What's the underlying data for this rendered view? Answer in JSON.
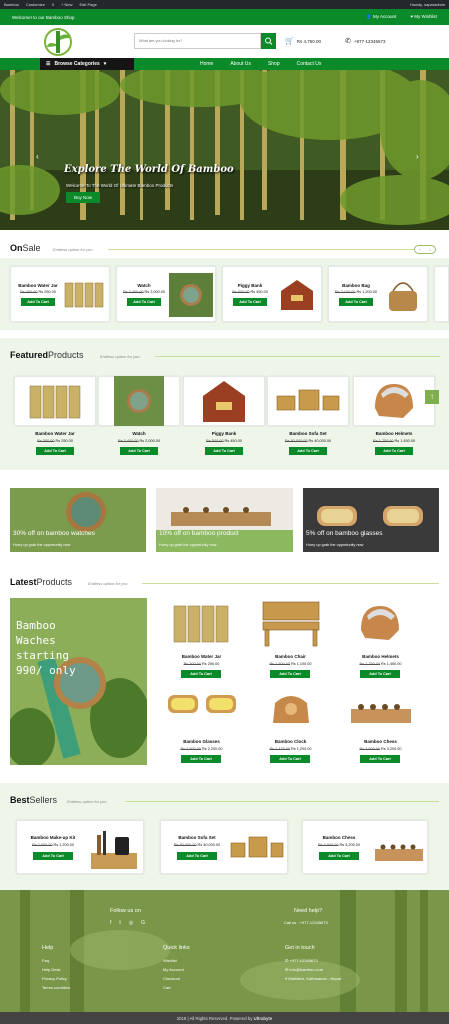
{
  "admin_bar": {
    "items": [
      "Bamboo",
      "Customize",
      "0",
      "+ New",
      "Edit Page"
    ],
    "howdy": "Howdy, saparadmin"
  },
  "topbar": {
    "welcome": "Welcome! to our Bamboo Shop",
    "account": "My Account",
    "wishlist": "My Wishlist"
  },
  "header": {
    "search_placeholder": "What are you looking for?",
    "cart_total": "Rs 4,750.00",
    "phone": "+977-12345673"
  },
  "nav": {
    "browse": "Browse Categories",
    "links": [
      "Home",
      "About Us",
      "Shop",
      "Contact Us"
    ]
  },
  "hero": {
    "title": "Explore The World Of Bamboo",
    "subtitle": "Welcome To The World Of Ultimate Bamboo Products",
    "button": "Buy Now"
  },
  "onsale": {
    "title_bold": "On",
    "title_rest": "Sale",
    "subtitle": "Endless option for you",
    "products": [
      {
        "name": "Bamboo Water Jar",
        "old": "Rs 300.00",
        "new": "Rs 250.00",
        "btn": "Add To Cart"
      },
      {
        "name": "Watch",
        "old": "Rs 2,400.00",
        "new": "Rs 2,000.00",
        "btn": "Add To Cart"
      },
      {
        "name": "Piggy Bank",
        "old": "Rs 500.00",
        "new": "Rs 450.00",
        "btn": "Add To Cart"
      },
      {
        "name": "Bamboo Bag",
        "old": "Rs 2,100.00",
        "new": "Rs 1,200.00",
        "btn": "Add To Cart"
      }
    ]
  },
  "featured": {
    "title_bold": "Featured",
    "title_rest": "Products",
    "subtitle": "Endless option for you",
    "products": [
      {
        "name": "Bamboo Water Jar",
        "old": "Rs 300.00",
        "new": "Rs 250.00",
        "btn": "Add To Cart"
      },
      {
        "name": "Watch",
        "old": "Rs 2,400.00",
        "new": "Rs 2,000.00",
        "btn": "Add To Cart"
      },
      {
        "name": "Piggy Bank",
        "old": "Rs 500.00",
        "new": "Rs 450.00",
        "btn": "Add To Cart"
      },
      {
        "name": "Bamboo Sofa Set",
        "old": "Rs 50,000.00",
        "new": "Rs 40,000.00",
        "btn": "Add To Cart"
      },
      {
        "name": "Bamboo Helmets",
        "old": "Rs 1,750.00",
        "new": "Rs 1,450.00",
        "btn": "Add To Cart"
      }
    ]
  },
  "promos": [
    {
      "title": "30% off on bamboo watches",
      "sub": "Hurry up grab the opportunity now"
    },
    {
      "title": "10% off on bamboo product",
      "sub": "Hurry up grab the opportunity now"
    },
    {
      "title": "5% off on bamboo glasses",
      "sub": "Hurry up grab the opportunity now"
    }
  ],
  "latest": {
    "title_bold": "Latest",
    "title_rest": "Products",
    "subtitle": "Endless option for you",
    "banner_lines": [
      "Bamboo",
      "Waches",
      "starting",
      "990/ only"
    ],
    "products": [
      {
        "name": "Bamboo Water Jar",
        "old": "Rs 300.00",
        "new": "Rs 250.00",
        "btn": "Add To Cart"
      },
      {
        "name": "Bamboo Chair",
        "old": "Rs 1,500.00",
        "new": "Rs 1,100.00",
        "btn": "Add To Cart"
      },
      {
        "name": "Bamboo Helmets",
        "old": "Rs 1,750.00",
        "new": "Rs 1,450.00",
        "btn": "Add To Cart"
      },
      {
        "name": "Bamboo Glasses",
        "old": "Rs 2,500.00",
        "new": "Rs 2,200.00",
        "btn": "Add To Cart"
      },
      {
        "name": "Bamboo Clock",
        "old": "Rs 1,425.00",
        "new": "Rs 1,200.00",
        "btn": "Add To Cart"
      },
      {
        "name": "Bamboo Chess",
        "old": "Rs 3,500.00",
        "new": "Rs 3,200.00",
        "btn": "Add To Cart"
      }
    ]
  },
  "best": {
    "title_bold": "Best",
    "title_rest": "Sellers",
    "subtitle": "Endless option for you",
    "products": [
      {
        "name": "Bamboo Make-up Kit",
        "old": "Rs 2,500.00",
        "new": "Rs 1,200.00",
        "btn": "Add To Cart"
      },
      {
        "name": "Bamboo Sofa Set",
        "old": "Rs 50,000.00",
        "new": "Rs 40,000.00",
        "btn": "Add To Cart"
      },
      {
        "name": "Bamboo Chess",
        "old": "Rs 3,500.00",
        "new": "Rs 3,200.00",
        "btn": "Add To Cart"
      }
    ]
  },
  "footer": {
    "follow": "Follow us on",
    "newsletter": "Need help?",
    "call": "Call us : +977-12345673",
    "help_title": "Help",
    "help_links": [
      "Faq",
      "Help Desk",
      "Privacy Policy",
      "Terms condition"
    ],
    "quick_title": "Quick links",
    "quick_links": [
      "Wishlist",
      "My Account",
      "Checkout",
      "Cart"
    ],
    "touch_title": "Get in touch",
    "touch": [
      "+977-12345673",
      "info@bamboo.com",
      "Maitidevi, Kathmandu - Nepal"
    ],
    "copyright": "2018 | All Rights Reserved. Powered by",
    "brand": "Ultrabyte"
  },
  "colors": {
    "primary": "#0b8a2a",
    "footer": "#6e8a3e",
    "section_bg": "#eef6ea"
  }
}
